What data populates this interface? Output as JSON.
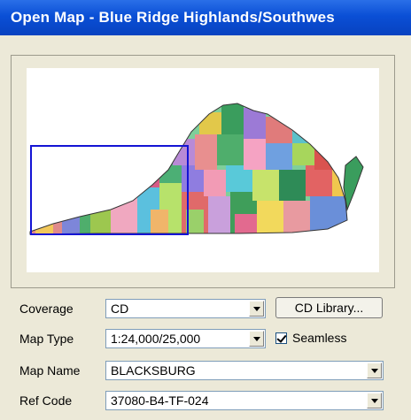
{
  "window": {
    "title": "Open Map - Blue Ridge Highlands/Southwes"
  },
  "form": {
    "coverage": {
      "label": "Coverage",
      "value": "CD"
    },
    "cd_library_button": "CD Library...",
    "map_type": {
      "label": "Map Type",
      "value": "1:24,000/25,000"
    },
    "seamless": {
      "label": "Seamless",
      "checked": true
    },
    "map_name": {
      "label": "Map Name",
      "value": "BLACKSBURG"
    },
    "ref_code": {
      "label": "Ref Code",
      "value": "37080-B4-TF-024"
    }
  },
  "colors": {
    "title_bar": "#0a4fd6",
    "selection_box": "#1414d4"
  }
}
